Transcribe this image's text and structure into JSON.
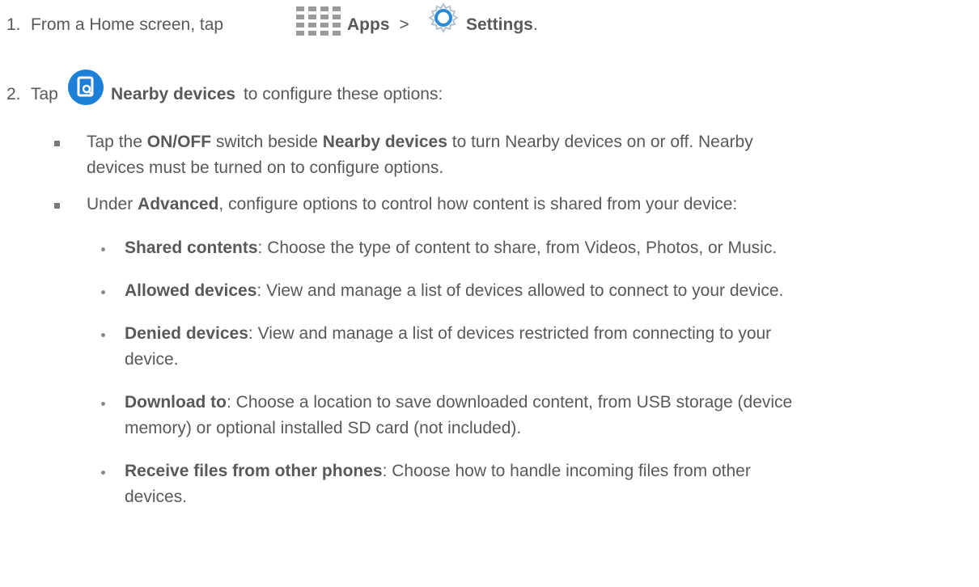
{
  "steps": [
    {
      "number": "1.",
      "text_pre": "From a Home screen, tap",
      "apps_icon": "apps-grid-icon",
      "apps_label": "Apps",
      "sep": ">",
      "settings_icon": "settings-gear-icon",
      "settings_label": "Settings",
      "end": "."
    },
    {
      "number": "2.",
      "text_pre": "Tap",
      "nearby_icon": "nearby-devices-icon",
      "nearby_label": "Nearby devices",
      "text_post": "to configure these options:"
    }
  ],
  "bullets": [
    {
      "p1": "Tap the ",
      "b1": "ON/OFF",
      "p2": " switch beside ",
      "b2": "Nearby devices",
      "p3": " to turn Nearby devices on or off. Nearby",
      "line2": "devices must be turned on to configure options."
    },
    {
      "p1": "Under ",
      "b1": "Advanced",
      "p2": ", configure options to control how content is shared from your device:"
    }
  ],
  "subbullets": [
    {
      "term": "Shared contents",
      "desc": ": Choose the type of content to share, from Videos, Photos, or Music."
    },
    {
      "term": "Allowed devices",
      "desc": ": View and manage a list of devices allowed to connect to your device."
    },
    {
      "term": "Denied devices",
      "desc": ": View and manage a list of devices restricted from connecting to your",
      "line2": "device."
    },
    {
      "term": "Download to",
      "desc": ": Choose a location to save downloaded content, from USB storage (device",
      "line2": "memory) or optional installed SD card (not included)."
    },
    {
      "term": "Receive files from other phones",
      "desc": ": Choose how to handle incoming files from other",
      "line2": "devices."
    }
  ],
  "colors": {
    "text": "#595959",
    "nearby_icon_bg": "#1d7fd6",
    "apps_icon": "#9a9a9a",
    "gear_icon": "#2a8bd8"
  }
}
